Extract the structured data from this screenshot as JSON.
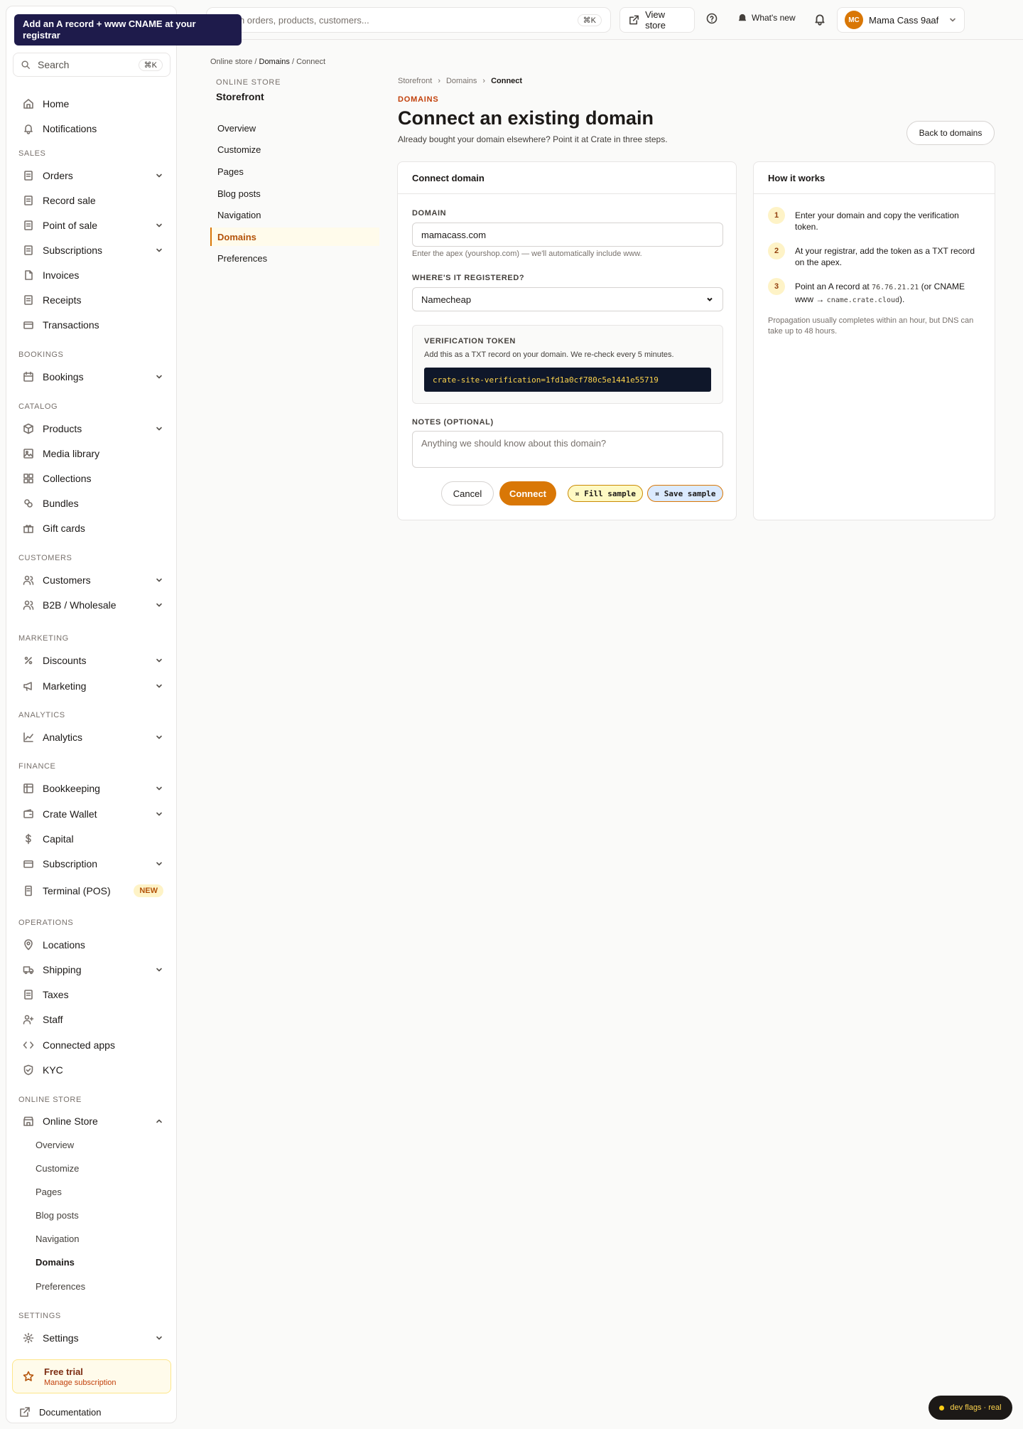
{
  "tooltip": "Add an A record + www CNAME at your registrar",
  "sidebar": {
    "search_label": "Search",
    "search_kbd": "⌘K",
    "items": {
      "home": "Home",
      "notifications": "Notifications",
      "orders": "Orders",
      "record_sale": "Record sale",
      "point_of_sale": "Point of sale",
      "subscriptions": "Subscriptions",
      "invoices": "Invoices",
      "receipts": "Receipts",
      "transactions": "Transactions",
      "bookings": "Bookings",
      "products": "Products",
      "media_library": "Media library",
      "collections": "Collections",
      "bundles": "Bundles",
      "gift_cards": "Gift cards",
      "customers": "Customers",
      "b2b": "B2B / Wholesale",
      "discounts": "Discounts",
      "marketing": "Marketing",
      "analytics": "Analytics",
      "bookkeeping": "Bookkeeping",
      "crate_wallet": "Crate Wallet",
      "capital": "Capital",
      "subscription": "Subscription",
      "terminal": "Terminal (POS)",
      "terminal_badge": "NEW",
      "locations": "Locations",
      "shipping": "Shipping",
      "taxes": "Taxes",
      "staff": "Staff",
      "connected_apps": "Connected apps",
      "kyc": "KYC",
      "online_store": "Online Store",
      "settings": "Settings"
    },
    "sections": {
      "sales": "SALES",
      "bookings": "BOOKINGS",
      "catalog": "CATALOG",
      "customers": "CUSTOMERS",
      "marketing": "MARKETING",
      "analytics": "ANALYTICS",
      "finance": "FINANCE",
      "operations": "OPERATIONS",
      "online_store": "ONLINE STORE",
      "settings": "SETTINGS"
    },
    "online_store_sub": [
      "Overview",
      "Customize",
      "Pages",
      "Blog posts",
      "Navigation",
      "Domains",
      "Preferences"
    ],
    "trial_title": "Free trial",
    "trial_link": "Manage subscription",
    "documentation": "Documentation"
  },
  "topbar": {
    "search_placeholder": "Search orders, products, customers...",
    "search_kbd": "⌘K",
    "view_store": "View store",
    "whats_new": "What's new",
    "account_initials": "MC",
    "account_name": "Mama Cass 9aaf"
  },
  "crumb_top": {
    "a": "Online store",
    "b": "Domains",
    "c": "Connect",
    "sep": "/"
  },
  "secondary_nav": {
    "label": "ONLINE STORE",
    "title": "Storefront",
    "items": [
      "Overview",
      "Customize",
      "Pages",
      "Blog posts",
      "Navigation",
      "Domains",
      "Preferences"
    ]
  },
  "main": {
    "crumb": [
      "Storefront",
      "Domains",
      "Connect"
    ],
    "eyebrow": "DOMAINS",
    "title": "Connect an existing domain",
    "subtitle": "Already bought your domain elsewhere? Point it at Crate in three steps.",
    "back_button": "Back to domains"
  },
  "form": {
    "card_title": "Connect domain",
    "domain_label": "DOMAIN",
    "domain_value": "mamacass.com",
    "domain_help": "Enter the apex (yourshop.com) — we'll automatically include www.",
    "registrar_label": "WHERE'S IT REGISTERED?",
    "registrar_value": "Namecheap",
    "token_label": "VERIFICATION TOKEN",
    "token_help": "Add this as a TXT record on your domain. We re-check every 5 minutes.",
    "token_value": "crate-site-verification=1fd1a0cf780c5e1441e55719",
    "notes_label": "NOTES (OPTIONAL)",
    "notes_placeholder": "Anything we should know about this domain?",
    "cancel": "Cancel",
    "connect": "Connect",
    "fill_sample": "¤ Fill sample",
    "save_sample": "¤ Save sample"
  },
  "how": {
    "title": "How it works",
    "step1_num": "1",
    "step1": "Enter your domain and copy the verification token.",
    "step2_num": "2",
    "step2": "At your registrar, add the token as a TXT record on the apex.",
    "step3_num": "3",
    "step3_a": "Point an A record at ",
    "step3_ip": "76.76.21.21",
    "step3_b": " (or CNAME www → ",
    "step3_cname": "cname.crate.cloud",
    "step3_c": ").",
    "propagation": "Propagation usually completes within an hour, but DNS can take up to 48 hours."
  },
  "dev_flags": "dev flags · real"
}
